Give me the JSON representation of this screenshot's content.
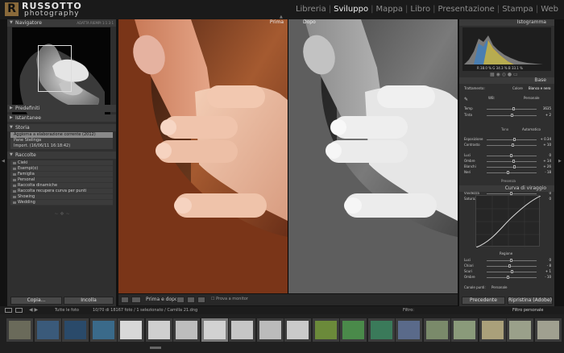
{
  "brand": {
    "initial": "R",
    "name": "RUSSOTTO",
    "sub": "photography"
  },
  "modules": [
    {
      "label": "Libreria",
      "active": false
    },
    {
      "label": "Sviluppo",
      "active": true
    },
    {
      "label": "Mappa",
      "active": false
    },
    {
      "label": "Libro",
      "active": false
    },
    {
      "label": "Presentazione",
      "active": false
    },
    {
      "label": "Stampa",
      "active": false
    },
    {
      "label": "Web",
      "active": false
    }
  ],
  "left": {
    "navigator": {
      "title": "Navigatore",
      "options": "ADATTA  RIEMPI  1:1  3:1"
    },
    "presets": {
      "title": "Predefiniti"
    },
    "snapshots": {
      "title": "Istantanee"
    },
    "history": {
      "title": "Storia",
      "items": [
        "Aggiorna a elaborazione corrente (2012)",
        "Pane Stelinga",
        "Import. (16/06/11 16:18:42)"
      ]
    },
    "collections": {
      "title": "Raccolte",
      "items": [
        "Cieki",
        "Esempi(o)",
        "Famiglia",
        "Personal",
        "Raccolta dinamiche",
        "Raccolta recupera curva per punti",
        "Showing",
        "Wedding"
      ]
    },
    "copy_label": "Copia...",
    "paste_label": "Incolla"
  },
  "center": {
    "before_label": "Prima",
    "after_label": "Dopo"
  },
  "toolbar": {
    "mode_label": "Prima e dopo:",
    "soft_proof": "Prova a monitor"
  },
  "right": {
    "histogram": {
      "title": "Istogramma",
      "readout": "R 38.0 %  G 34.3 %  B 33.1 %"
    },
    "basic": {
      "title": "Base",
      "treatment": "Trattamento:",
      "color": "Colore",
      "bw": "Bianco e nero"
    },
    "wb": {
      "label": "WB:",
      "value": "Personale"
    },
    "temp": {
      "label": "Temp",
      "value": "3635"
    },
    "tint": {
      "label": "Tinta",
      "value": "+ 2"
    },
    "tone": {
      "label": "Tono",
      "auto": "Automatico"
    },
    "exposure": {
      "label": "Esposizione",
      "value": "+ 0.34"
    },
    "contrast": {
      "label": "Contrasto",
      "value": "+ 10"
    },
    "highlights": {
      "label": "Luci",
      "value": "0"
    },
    "shadows": {
      "label": "Ombre",
      "value": "+ 14"
    },
    "whites": {
      "label": "Bianchi",
      "value": "+ 26"
    },
    "blacks": {
      "label": "Neri",
      "value": "- 18"
    },
    "presence": {
      "label": "Presenza"
    },
    "clarity": {
      "label": "Chiarezza",
      "value": "+ 10"
    },
    "vibrance": {
      "label": "Vividezza",
      "value": "0"
    },
    "saturation": {
      "label": "Saturazione",
      "value": "0"
    },
    "curve": {
      "title": "Curva di viraggio",
      "region": "Regione",
      "ch_label": "Canale punti:",
      "ch_value": "Personale"
    },
    "luci_c": {
      "label": "Luci",
      "value": "0"
    },
    "chiari": {
      "label": "Chiari",
      "value": "- 8"
    },
    "scuri": {
      "label": "Scuri",
      "value": "+ 1"
    },
    "ombre_c": {
      "label": "Ombre",
      "value": "- 10"
    },
    "prev_button": "Precedente",
    "reset_button": "Ripristina (Adobe)"
  },
  "bottom": {
    "source": "Tutte le foto",
    "count": "10/70 di 18167 foto / 1 selezionato / Camilla 21.dng",
    "filter": "Filtro:",
    "filter_value": "Filtro personale"
  },
  "colors": {
    "accent": "#f0f0f0",
    "panel": "#2f2f2f",
    "background": "#121212"
  }
}
